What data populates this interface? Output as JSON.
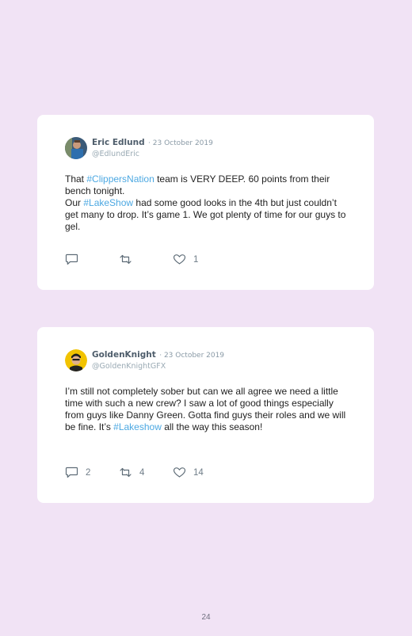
{
  "tweets": [
    {
      "name": "Eric Edlund",
      "date": "· 23 October 2019",
      "handle": "@EdlundEric",
      "lines": [
        [
          {
            "t": "That "
          },
          {
            "t": "#ClippersNation",
            "tag": true
          },
          {
            "t": " team is VERY DEEP. 60 points from their bench tonight."
          }
        ],
        [
          {
            "t": "Our "
          },
          {
            "t": "#LakeShow",
            "tag": true
          },
          {
            "t": " had some good looks in the 4th but just couldn’t get many to drop. It’s game 1. We got plenty of time for our guys to gel."
          }
        ]
      ],
      "replies": "",
      "retweets": "",
      "likes": "1"
    },
    {
      "name": "GoldenKnight",
      "date": "· 23 October 2019",
      "handle": "@GoldenKnightGFX",
      "lines": [
        [
          {
            "t": "I’m still not completely sober but can we all agree we need a little time with such a new crew? I saw a lot of good things especially from guys like Danny Green. Gotta find guys their roles and we will be fine. It’s "
          },
          {
            "t": "#Lakeshow",
            "tag": true
          },
          {
            "t": " all the way this season!"
          }
        ]
      ],
      "replies": "2",
      "retweets": "4",
      "likes": "14"
    }
  ],
  "page_number": "24",
  "colors": {
    "background": "#f1e3f5",
    "hashtag": "#4ca8e2",
    "card": "#ffffff"
  },
  "icons": [
    "reply-icon",
    "retweet-icon",
    "like-icon"
  ]
}
